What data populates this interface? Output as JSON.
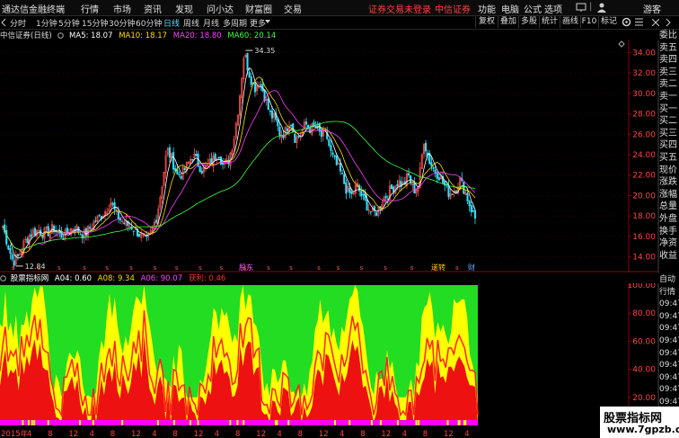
{
  "menubar": {
    "app_title": "通达信金融终端",
    "items": [
      "行情",
      "市场",
      "资讯",
      "发现",
      "问小达",
      "财富圈",
      "交易"
    ],
    "login_notice": "证券交易未登录",
    "broker": "中信证券",
    "right_items": [
      "功能",
      "电脑",
      "公式",
      "选项"
    ],
    "guest": "游客"
  },
  "toolbar": {
    "periods": [
      "分时",
      "1分钟",
      "5分钟",
      "15分钟",
      "30分钟",
      "60分钟",
      "日线",
      "周线",
      "月线",
      "多周期",
      "更多"
    ],
    "active_period": "日线",
    "right_buttons": [
      "复权",
      "叠加",
      "多股",
      "统计",
      "画线",
      "F10",
      "标记"
    ]
  },
  "infobar": {
    "stock": "中信证券(日线)",
    "ma5_label": "MA5: 18.07",
    "ma10_label": "MA10: 18.17",
    "ma20_label": "MA20: 18.80",
    "ma60_label": "MA60: 20.14"
  },
  "colors": {
    "ma5": "#ffffff",
    "ma10": "#ffdd00",
    "ma20": "#ff40ff",
    "ma60": "#40ff40",
    "up": "#ff5050",
    "down": "#33e0ff",
    "grid": "#8b0000",
    "axis_text": "#ff4444"
  },
  "chart_data": [
    {
      "type": "candlestick",
      "title": "中信证券(日线)",
      "ylim": [
        13,
        35
      ],
      "yticks": [
        14.0,
        16.0,
        18.0,
        20.0,
        22.0,
        24.0,
        26.0,
        28.0,
        30.0,
        32.0,
        34.0
      ],
      "max_label": "34.35",
      "min_label": "12.84",
      "event_labels": [
        "股东",
        "送转",
        "财"
      ],
      "series": [
        {
          "name": "MA5",
          "value": 18.07
        },
        {
          "name": "MA10",
          "value": 18.17
        },
        {
          "name": "MA20",
          "value": 18.8
        },
        {
          "name": "MA60",
          "value": 20.14
        }
      ],
      "close_path": [
        17.0,
        15.2,
        13.5,
        14.0,
        15.2,
        16.0,
        16.5,
        16.6,
        16.3,
        16.5,
        16.8,
        16.2,
        16.0,
        16.6,
        17.0,
        16.4,
        16.2,
        16.8,
        17.5,
        18.0,
        18.5,
        19.5,
        18.2,
        17.6,
        17.2,
        17.0,
        16.6,
        16.0,
        15.4,
        16.5,
        18.0,
        21.0,
        24.5,
        23.5,
        22.0,
        22.2,
        23.0,
        24.0,
        23.2,
        22.4,
        23.0,
        23.5,
        24.3,
        22.8,
        23.5,
        25.5,
        29.0,
        34.0,
        32.0,
        30.5,
        31.2,
        29.8,
        28.0,
        27.5,
        26.0,
        26.2,
        27.5,
        25.5,
        26.0,
        27.0,
        26.5,
        26.8,
        25.8,
        26.0,
        24.0,
        23.0,
        22.0,
        20.5,
        20.0,
        21.0,
        19.8,
        19.0,
        18.2,
        18.5,
        19.6,
        20.2,
        20.8,
        21.4,
        21.0,
        22.0,
        20.5,
        21.0,
        25.5,
        23.5,
        22.5,
        22.0,
        21.0,
        20.2,
        20.6,
        21.5,
        20.5,
        19.0,
        17.8
      ]
    },
    {
      "type": "area",
      "title": "股票指标网",
      "ylim": [
        0,
        100
      ],
      "yticks": [
        20,
        40,
        60,
        80,
        100
      ],
      "series": [
        {
          "name": "A04",
          "value": 0.6
        },
        {
          "name": "A08",
          "value": 9.34
        },
        {
          "name": "A06",
          "value": 90.07
        },
        {
          "name": "获利",
          "value": 0.46
        }
      ]
    }
  ],
  "indicator_bar": {
    "name": "股票指标网",
    "a04": "A04: 0.60",
    "a08": "A08: 9.34",
    "a06": "A06: 90.07",
    "profit": "获利: 0.46"
  },
  "side_panel": [
    "委比",
    "卖五",
    "卖四",
    "卖三",
    "卖二",
    "卖一",
    "买一",
    "买二",
    "买三",
    "买四",
    "买五",
    "现价",
    "涨跌",
    "涨幅",
    "总量",
    "外盘",
    "换手",
    "净资",
    "收益"
  ],
  "side_panel2": [
    "自动",
    "行情",
    "09:47",
    "09:47",
    "09:47",
    "09:47",
    "09:47",
    "09:47",
    "09:47",
    "09:47",
    "09:47",
    "09:47"
  ],
  "bottom_axis": [
    "2015年",
    "4",
    "8",
    "12",
    "4",
    "8",
    "12",
    "4",
    "8",
    "12",
    "4",
    "8",
    "12",
    "4",
    "8",
    "12",
    "4",
    "8",
    "12",
    "4",
    "8",
    "12",
    "4"
  ],
  "watermark": {
    "line1": "股票指标网",
    "line2": "www.7gpzb.com"
  }
}
